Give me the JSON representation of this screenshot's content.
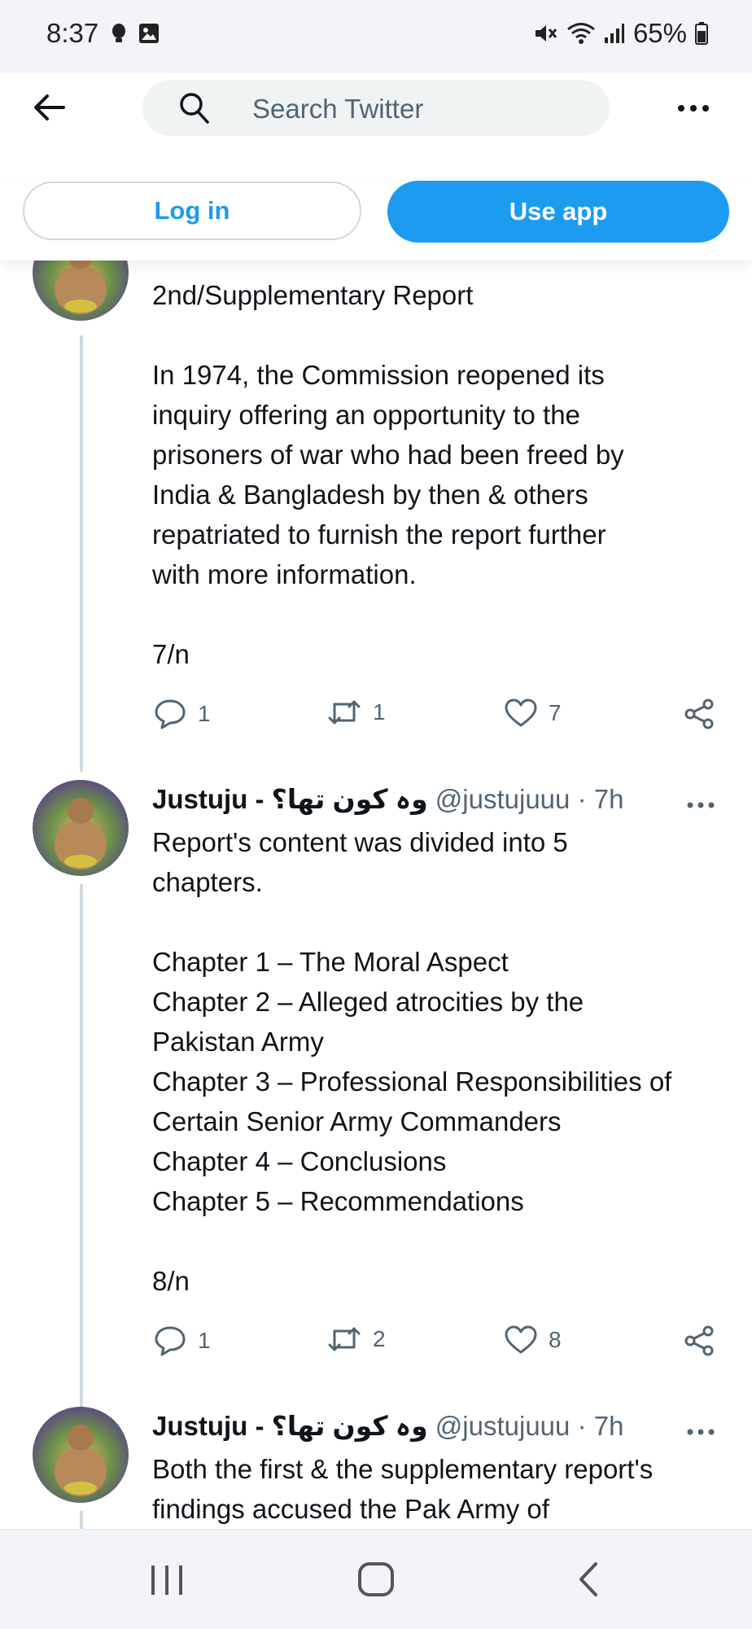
{
  "status_bar": {
    "time": "8:37",
    "battery": "65%",
    "left_icons": [
      "notification-dot-icon",
      "image-icon"
    ],
    "right_icons": [
      "mute-icon",
      "wifi-icon",
      "signal-icon",
      "battery-icon"
    ]
  },
  "header": {
    "search_placeholder": "Search Twitter"
  },
  "buttons": {
    "login": "Log in",
    "use_app": "Use app"
  },
  "tweets": [
    {
      "lines": [
        "2nd/Supplementary Report",
        "",
        "In 1974, the Commission reopened its",
        "inquiry offering an opportunity to the",
        "prisoners of war who had been freed by",
        "India & Bangladesh by then & others",
        "repatriated to furnish the report further",
        "with more information.",
        "",
        "7/n"
      ],
      "replies": "1",
      "retweets": "1",
      "likes": "7"
    },
    {
      "name": "Justuju - وہ کون تھا؟",
      "handle": "@justujuuu",
      "time": "· 7h",
      "lines": [
        "Report's content was divided into 5",
        "chapters.",
        "",
        "Chapter 1 – The Moral Aspect",
        "Chapter 2 – Alleged atrocities by the",
        "Pakistan Army",
        "Chapter 3 – Professional Responsibilities of",
        "Certain Senior Army Commanders",
        "Chapter 4 – Conclusions",
        "Chapter 5 – Recommendations",
        "",
        "8/n"
      ],
      "replies": "1",
      "retweets": "2",
      "likes": "8"
    },
    {
      "name": "Justuju - وہ کون تھا؟",
      "handle": "@justujuuu",
      "time": "· 7h",
      "lines": [
        "Both the first & the supplementary report's",
        "findings accused the Pak Army of"
      ]
    }
  ],
  "colors": {
    "accent": "#1d9bf0",
    "text": "#0f1419",
    "secondary": "#536471",
    "thread_line": "#cfd9de"
  }
}
